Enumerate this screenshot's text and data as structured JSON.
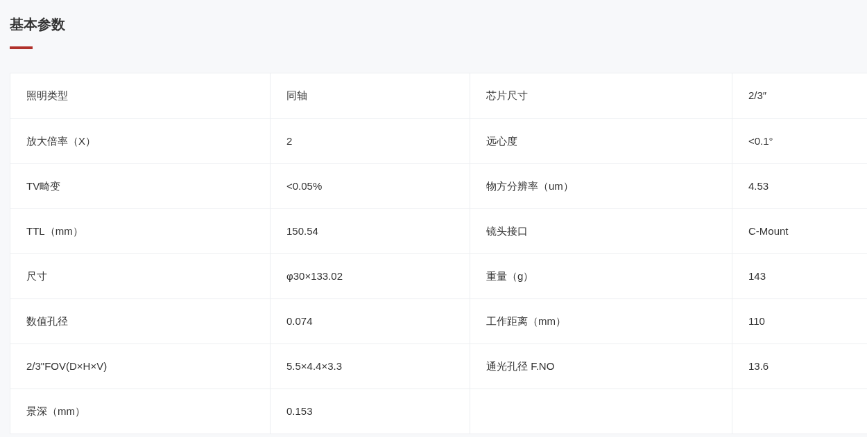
{
  "section_title": "基本参数",
  "table": {
    "rows": [
      [
        "照明类型",
        "同轴",
        "芯片尺寸",
        "2/3″"
      ],
      [
        "放大倍率（X）",
        "2",
        "远心度",
        "<0.1°"
      ],
      [
        "TV畸变",
        "<0.05%",
        "物方分辨率（um）",
        "4.53"
      ],
      [
        "TTL（mm）",
        "150.54",
        "镜头接口",
        "C-Mount"
      ],
      [
        "尺寸",
        "φ30×133.02",
        "重量（g）",
        "143"
      ],
      [
        "数值孔径",
        "0.074",
        "工作距离（mm）",
        "110"
      ],
      [
        "2/3\"FOV(D×H×V)",
        "5.5×4.4×3.3",
        "通光孔径 F.NO",
        "13.6"
      ],
      [
        "景深（mm）",
        "0.153"
      ]
    ]
  }
}
